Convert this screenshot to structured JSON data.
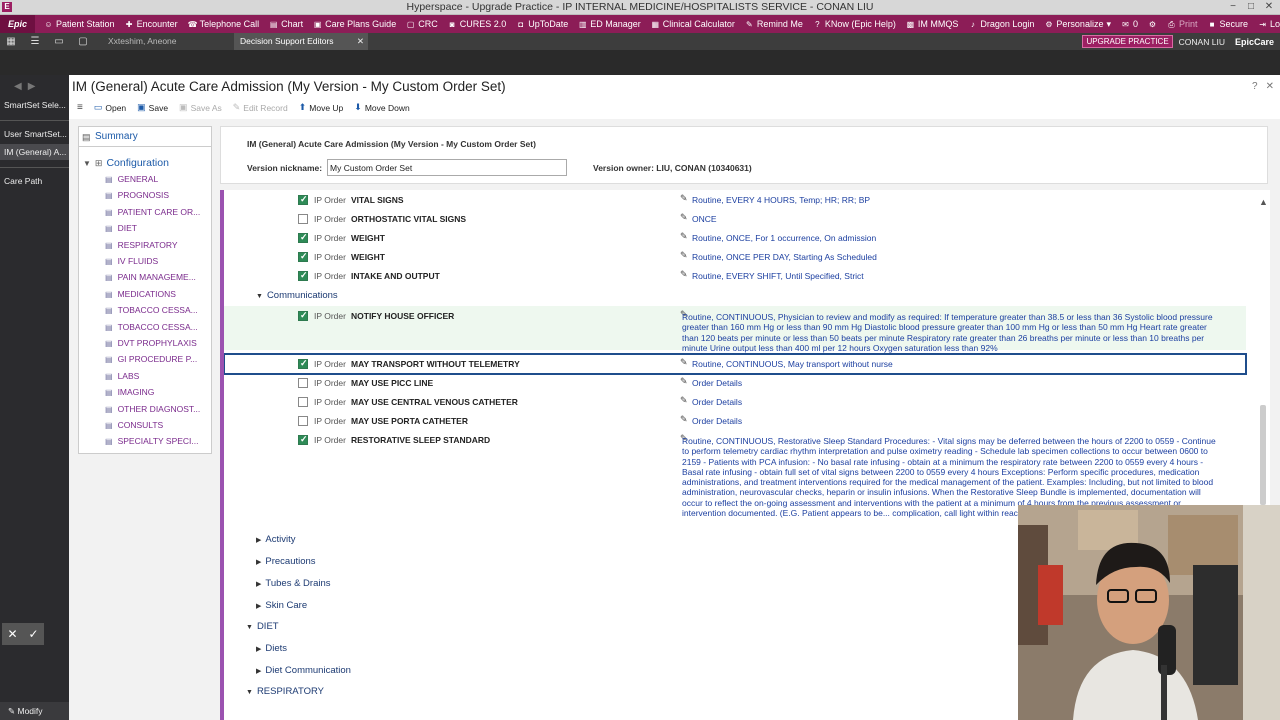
{
  "window": {
    "title": "Hyperspace - Upgrade Practice - IP INTERNAL MEDICINE/HOSPITALISTS  SERVICE - CONAN LIU",
    "app_icon": "E",
    "controls": [
      "−",
      "□",
      "✕"
    ]
  },
  "toolbar": {
    "logo": "Epic",
    "items": [
      {
        "label": "Patient Station",
        "icon": "patient-icon"
      },
      {
        "label": "Encounter",
        "icon": "encounter-icon"
      },
      {
        "label": "Telephone Call",
        "icon": "phone-icon"
      },
      {
        "label": "Chart",
        "icon": "chart-icon"
      },
      {
        "label": "Care Plans Guide",
        "icon": "care-plan-icon"
      },
      {
        "label": "CRC",
        "icon": "crc-icon"
      },
      {
        "label": "CURES 2.0",
        "icon": "cures-icon"
      },
      {
        "label": "UpToDate",
        "icon": "uptodate-icon"
      },
      {
        "label": "ED Manager",
        "icon": "ed-icon"
      },
      {
        "label": "Clinical Calculator",
        "icon": "calculator-icon"
      },
      {
        "label": "Remind Me",
        "icon": "remind-icon"
      },
      {
        "label": "KNow (Epic Help)",
        "icon": "help-icon"
      },
      {
        "label": "IM MMQS",
        "icon": "mmqs-icon"
      },
      {
        "label": "Dragon Login",
        "icon": "microphone-icon"
      },
      {
        "label": "Personalize",
        "icon": "wrench-icon"
      }
    ],
    "right": {
      "mail_count": "0",
      "print": "Print",
      "secure": "Secure",
      "logout": "Log Out"
    }
  },
  "tabstrip": {
    "tabs": [
      {
        "label": "Xxteshim, Aneone"
      },
      {
        "label": "Decision Support Editors",
        "close": "✕"
      }
    ],
    "upgrade_badge": "UPGRADE PRACTICE",
    "user": "CONAN LIU",
    "brand": "EpicCare"
  },
  "leftrail": {
    "items": [
      "SmartSet Sele...",
      "User SmartSet...",
      "IM (General) A...",
      "Care Path"
    ],
    "modify": "Modify"
  },
  "header": {
    "title": "IM (General) Acute Care Admission (My Version - My Custom Order Set)",
    "actions": [
      {
        "label": "Open",
        "enabled": true
      },
      {
        "label": "Save",
        "enabled": true
      },
      {
        "label": "Save As",
        "enabled": false
      },
      {
        "label": "Edit Record",
        "enabled": false
      },
      {
        "label": "Move Up",
        "enabled": true
      },
      {
        "label": "Move Down",
        "enabled": true
      }
    ]
  },
  "nav": {
    "summary": "Summary",
    "configuration": "Configuration",
    "items": [
      "GENERAL",
      "PROGNOSIS",
      "PATIENT CARE OR...",
      "DIET",
      "RESPIRATORY",
      "IV FLUIDS",
      "PAIN MANAGEME...",
      "MEDICATIONS",
      "TOBACCO CESSA...",
      "TOBACCO CESSA...",
      "DVT PROPHYLAXIS",
      "GI PROCEDURE P...",
      "LABS",
      "IMAGING",
      "OTHER DIAGNOST...",
      "CONSULTS",
      "SPECIALTY SPECI..."
    ]
  },
  "info": {
    "title": "IM (General) Acute Care Admission (My Version - My Custom Order Set)",
    "nickname_label": "Version nickname:",
    "nickname_value": "My Custom Order Set",
    "owner": "Version owner:  LIU, CONAN (10340631)"
  },
  "orders": {
    "top_rows": [
      {
        "type": "IP Order",
        "name": "VITAL SIGNS",
        "checked": true,
        "details": "Routine, EVERY 4 HOURS, Temp; HR; RR; BP"
      },
      {
        "type": "IP Order",
        "name": "ORTHOSTATIC VITAL SIGNS",
        "checked": false,
        "details": "ONCE"
      },
      {
        "type": "IP Order",
        "name": "WEIGHT",
        "checked": true,
        "details": "Routine, ONCE, For 1 occurrence, On admission"
      },
      {
        "type": "IP Order",
        "name": "WEIGHT",
        "checked": true,
        "details": "Routine, ONCE PER DAY, Starting As Scheduled"
      },
      {
        "type": "IP Order",
        "name": "INTAKE AND OUTPUT",
        "checked": true,
        "details": "Routine, EVERY SHIFT, Until Specified, Strict"
      }
    ],
    "communications_label": "Communications",
    "notify": {
      "type": "IP Order",
      "name": "NOTIFY HOUSE OFFICER",
      "checked": true,
      "details": "Routine, CONTINUOUS, Physician to review and modify as required: If temperature greater than 38.5 or less than 36 Systolic blood pressure greater than 160 mm Hg or less than 90 mm Hg Diastolic blood pressure greater than 100 mm Hg or less than 50 mm Hg Heart rate greater than 120 beats per minute or less than 50 beats per minute Respiratory rate greater than 26 breaths per minute or less than 10 breaths per minute Urine output less than 400 ml per 12 hours Oxygen saturation less than 92%"
    },
    "mid_rows": [
      {
        "type": "IP Order",
        "name": "MAY TRANSPORT WITHOUT TELEMETRY",
        "checked": true,
        "details": "Routine, CONTINUOUS, May transport without nurse"
      },
      {
        "type": "IP Order",
        "name": "MAY USE PICC LINE",
        "checked": false,
        "details": "Order Details"
      },
      {
        "type": "IP Order",
        "name": "MAY USE CENTRAL VENOUS CATHETER",
        "checked": false,
        "details": "Order Details"
      },
      {
        "type": "IP Order",
        "name": "MAY USE PORTA CATHETER",
        "checked": false,
        "details": "Order Details"
      }
    ],
    "sleep": {
      "type": "IP Order",
      "name": "RESTORATIVE SLEEP STANDARD",
      "checked": true,
      "details": "Routine, CONTINUOUS, Restorative Sleep Standard Procedures: - Vital signs may be deferred between the hours of 2200 to 0559 - Continue to perform telemetry cardiac rhythm interpretation and pulse oximetry reading - Schedule lab specimen collections to occur between 0600 to 2159 - Patients with PCA infusion: - No basal rate infusing - obtain at a minimum the respiratory rate between 2200 to 0559 every 4 hours - Basal rate infusing - obtain full set of vital signs between 2200 to 0559 every 4 hours Exceptions: Perform specific procedures, medication administrations, and treatment interventions required for the medical management of the patient. Examples: Including, but not limited to blood administration, neurovascular checks, heparin or insulin infusions. When the Restorative Sleep Bundle is implemented, documentation will occur to reflect the on-going assessment and interventions with the patient at a minimum of 4 hours from the previous assessment or intervention documented. (E.G. Patient appears to be... complication, call light within reach)."
    },
    "collapsed_groups": [
      "Activity",
      "Precautions",
      "Tubes & Drains",
      "Skin Care"
    ],
    "diet_section": "DIET",
    "diet_groups": [
      "Diets",
      "Diet Communication"
    ],
    "respiratory_section": "RESPIRATORY"
  }
}
